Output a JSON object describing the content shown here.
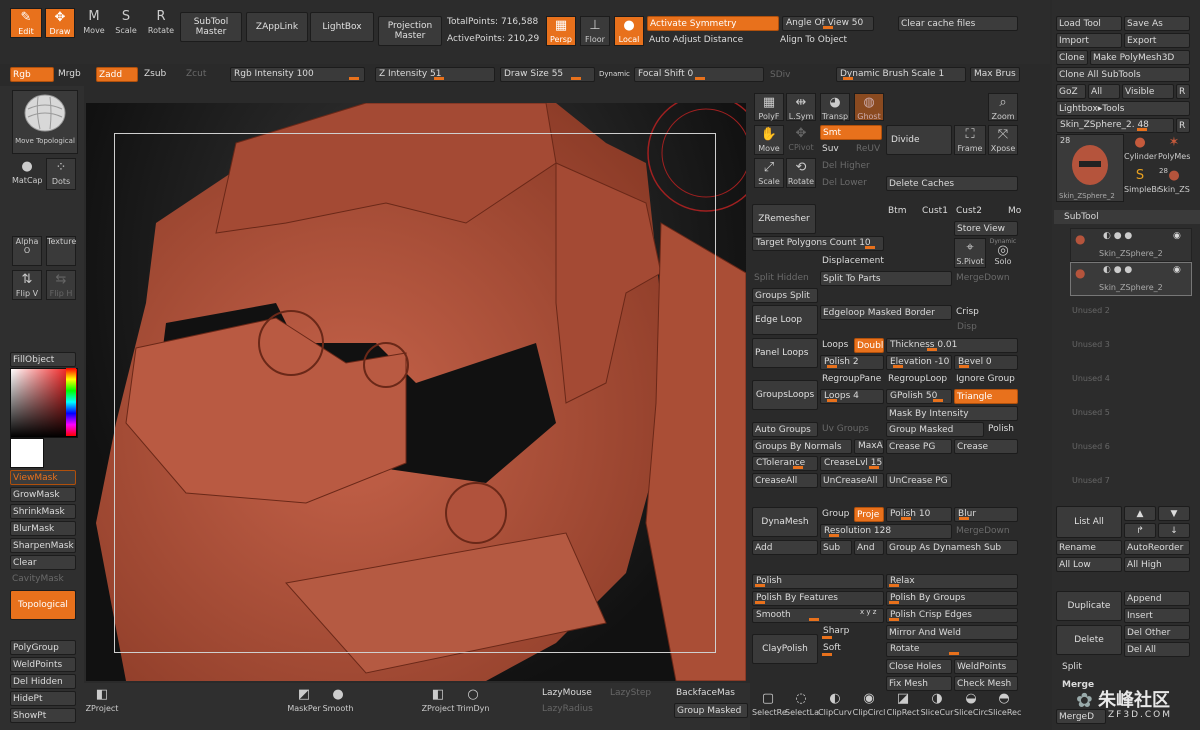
{
  "top_tools": {
    "edit": "Edit",
    "draw": "Draw",
    "move": "Move",
    "scale": "Scale",
    "rotate": "Rotate",
    "subtool_master": "SubTool Master",
    "zapplink": "ZAppLink",
    "lightbox": "LightBox",
    "projection_master": "Projection Master"
  },
  "stats": {
    "total_points": "TotalPoints: 716,588",
    "active_points": "ActivePoints: 210,29"
  },
  "view": {
    "persp": "Persp",
    "floor": "Floor",
    "local": "Local",
    "activate_symmetry": "Activate Symmetry",
    "auto_adjust": "Auto Adjust Distance",
    "angle_of_view": "Angle Of View 50",
    "align_to_object": "Align To Object",
    "clear_cache": "Clear cache files"
  },
  "second_row": {
    "rgb": "Rgb",
    "mrgb": "Mrgb",
    "zadd": "Zadd",
    "zsub": "Zsub",
    "zcut": "Zcut",
    "rgb_intensity": "Rgb Intensity 100",
    "z_intensity": "Z Intensity 51",
    "draw_size": "Draw Size 55",
    "dynamic": "Dynamic",
    "focal_shift": "Focal Shift 0",
    "sdiv": "SDiv",
    "dynamic_brush_scale": "Dynamic Brush Scale 1",
    "max_brush": "Max Brus"
  },
  "right_tool": {
    "load_tool": "Load Tool",
    "save_as": "Save As",
    "import": "Import",
    "export": "Export",
    "clone": "Clone",
    "make_polymesh": "Make PolyMesh3D",
    "clone_all": "Clone All SubTools",
    "goz": "GoZ",
    "all": "All",
    "visible": "Visible",
    "r": "R",
    "lightbox_tools": "Lightbox▸Tools",
    "skin_name": "Skin_ZSphere_2. 48",
    "thumb_count1": "28",
    "thumb_count2": "28",
    "cylinder": "Cylinder",
    "polymesh": "PolyMes",
    "simplebr": "SimpleBr",
    "skin_short": "Skin_ZS",
    "skin_thumb": "Skin_ZSphere_2",
    "subtool": "SubTool",
    "subtool_item1": "Skin_ZSphere_2",
    "subtool_item2": "Skin_ZSphere_2",
    "unused": [
      "Unused 2",
      "Unused 3",
      "Unused 4",
      "Unused 5",
      "Unused 6",
      "Unused 7"
    ],
    "list_all": "List All",
    "rename": "Rename",
    "autoreorder": "AutoReorder",
    "all_low": "All Low",
    "all_high": "All High",
    "duplicate": "Duplicate",
    "append": "Append",
    "insert": "Insert",
    "delete": "Delete",
    "del_other": "Del Other",
    "del_all": "Del All",
    "split": "Split",
    "merge": "Merge",
    "merge_down": "MergeD"
  },
  "left": {
    "brush": "Move Topological",
    "matcap": "MatCap",
    "dots": "Dots",
    "alpha": "Alpha O",
    "texture": "Texture",
    "flip_v": "Flip V",
    "flip_h": "Flip H",
    "fill_object": "FillObject",
    "viewmask": "ViewMask",
    "growmask": "GrowMask",
    "shrinkmask": "ShrinkMask",
    "blurmask": "BlurMask",
    "sharpenmask": "SharpenMask",
    "clear": "Clear",
    "cavitymask": "CavityMask",
    "topological": "Topological",
    "polygroup": "PolyGroup",
    "weldpoints": "WeldPoints",
    "del_hidden": "Del Hidden",
    "hidept": "HidePt",
    "showpt": "ShowPt"
  },
  "bottom": {
    "zproject": "ZProject",
    "maskper": "MaskPer",
    "smooth": "Smooth",
    "zproject2": "ZProject",
    "trimdyn": "TrimDyn",
    "lazymouse": "LazyMouse",
    "lazystep": "LazyStep",
    "lazyradius": "LazyRadius",
    "backfacemask": "BackfaceMas",
    "group_masked": "Group Masked",
    "icons": [
      "SelectRe",
      "SelectLa",
      "ClipCurv",
      "ClipCircl",
      "ClipRect",
      "SliceCur",
      "SliceCirc",
      "SliceRec"
    ]
  },
  "tools_panel": {
    "polyf": "PolyF",
    "lsym": "L.Sym",
    "transp": "Transp",
    "ghost": "Ghost",
    "zoom": "Zoom",
    "move": "Move",
    "cpivot": "CPivot",
    "smt": "Smt",
    "suv": "Suv",
    "reuv": "ReUV",
    "divide": "Divide",
    "frame": "Frame",
    "xpose": "Xpose",
    "del_higher": "Del Higher",
    "del_lower": "Del Lower",
    "scale": "Scale",
    "rotate": "Rotate",
    "delete_caches": "Delete Caches",
    "zremesher": "ZRemesher",
    "btm": "Btm",
    "cust1": "Cust1",
    "cust2": "Cust2",
    "mo": "Mo",
    "store_view": "Store View",
    "target_polygons": "Target Polygons Count 10",
    "spivot": "S.Pivot",
    "solo": "Solo",
    "dynamic": "Dynamic",
    "displacement": "Displacement",
    "split_hidden": "Split Hidden",
    "split_to_parts": "Split To Parts",
    "merge_down": "MergeDown",
    "groups_split": "Groups Split",
    "edge_loop": "Edge Loop",
    "edgeloop_masked": "Edgeloop Masked Border",
    "crisp": "Crisp",
    "disp": "Disp",
    "panel_loops": "Panel Loops",
    "loops": "Loops",
    "double": "Doubl",
    "thickness": "Thickness 0.01",
    "polish2": "Polish 2",
    "elevation": "Elevation -10",
    "bevel": "Bevel 0",
    "regroup_panel": "RegroupPane",
    "regroup_loop": "RegroupLoop",
    "ignore_groups": "Ignore Group",
    "groupsloops": "GroupsLoops",
    "loops4": "Loops 4",
    "gpolish": "GPolish 50",
    "triangle": "Triangle",
    "mask_by_intensity": "Mask By Intensity",
    "auto_groups": "Auto Groups",
    "uv_groups": "Uv Groups",
    "group_masked": "Group Masked",
    "polish": "Polish",
    "groups_by_normals": "Groups By Normals",
    "maxangle": "MaxAr",
    "crease_pg": "Crease PG",
    "crease": "Crease",
    "ctolerance": "CTolerance",
    "creaselvl": "CreaseLvl 15",
    "creaseall": "CreaseAll",
    "uncreaseall": "UnCreaseAll",
    "uncrease_pg": "UnCrease PG",
    "dynamesh": "DynaMesh",
    "group": "Group",
    "project": "Proje",
    "polish10": "Polish 10",
    "blur": "Blur",
    "resolution": "Resolution 128",
    "mergedown2": "MergeDown",
    "add": "Add",
    "sub": "Sub",
    "and": "And",
    "group_as_dynamesh": "Group As Dynamesh Sub",
    "polish_lbl": "Polish",
    "relax": "Relax",
    "polish_by_features": "Polish By Features",
    "polish_by_groups": "Polish By Groups",
    "smooth": "Smooth",
    "xyz": "x y z",
    "polish_crisp": "Polish Crisp Edges",
    "claypolish": "ClayPolish",
    "sharp": "Sharp",
    "soft": "Soft",
    "mirror_weld": "Mirror And Weld",
    "rotate2": "Rotate",
    "close_holes": "Close Holes",
    "weldpoints": "WeldPoints",
    "fix_mesh": "Fix Mesh",
    "check_mesh": "Check Mesh"
  },
  "watermark": {
    "text": "朱峰社区",
    "url": "ZF3D.COM"
  },
  "colors": {
    "accent": "#e8711c",
    "model": "#b5543c"
  }
}
